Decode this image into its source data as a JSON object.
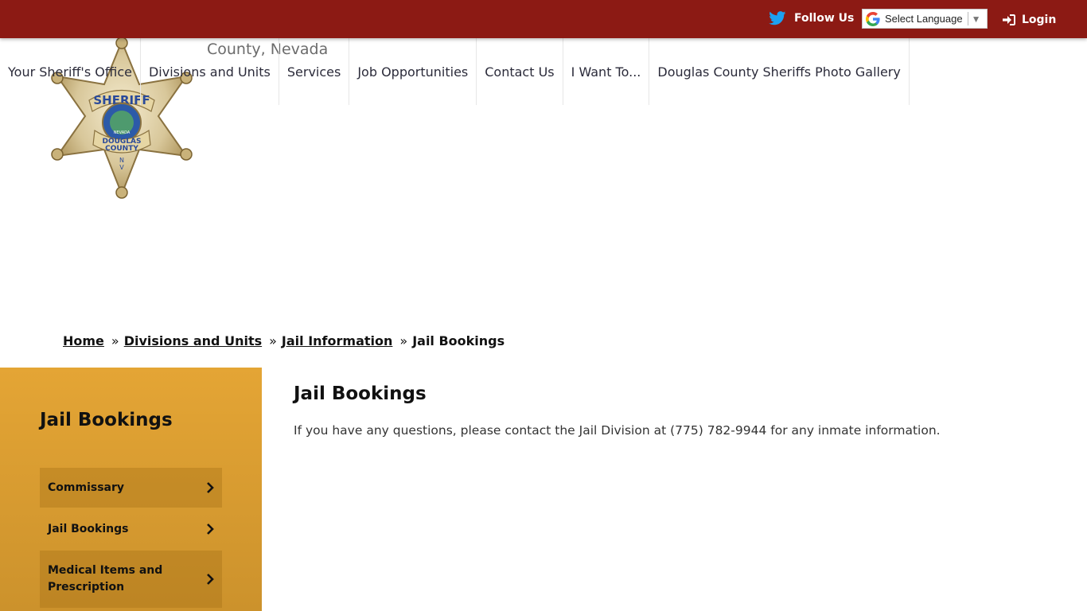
{
  "topbar": {
    "follow_label": "Follow Us",
    "language_label": "Select Language",
    "language_arrow": "▼",
    "login_label": "Login",
    "bg_color": "#8c1a14"
  },
  "header": {
    "county_text": "County, Nevada",
    "badge_text": {
      "top": "SHERIFF",
      "state": "NEVADA",
      "county_line1": "DOUGLAS",
      "county_line2": "COUNTY",
      "n": "N",
      "v": "V"
    }
  },
  "nav": {
    "items": [
      {
        "label": "Your Sheriff's Office"
      },
      {
        "label": "Divisions and Units"
      },
      {
        "label": "Services"
      },
      {
        "label": "Job Opportunities"
      },
      {
        "label": "Contact Us"
      },
      {
        "label": "I Want To..."
      },
      {
        "label": "Douglas County Sheriffs Photo Gallery"
      }
    ]
  },
  "breadcrumb": {
    "home": "Home",
    "divisions": "Divisions and Units",
    "jail_info": "Jail Information",
    "current": "Jail Bookings",
    "separator": "»"
  },
  "sidebar": {
    "title": "Jail Bookings",
    "items": [
      {
        "label": "Commissary"
      },
      {
        "label": "Jail Bookings"
      },
      {
        "label": "Medical Items and Prescription"
      }
    ],
    "accent_color": "#e4a535"
  },
  "content": {
    "title": "Jail Bookings",
    "text": "If you have any questions, please contact the Jail Division at (775) 782-9944 for any inmate information."
  }
}
